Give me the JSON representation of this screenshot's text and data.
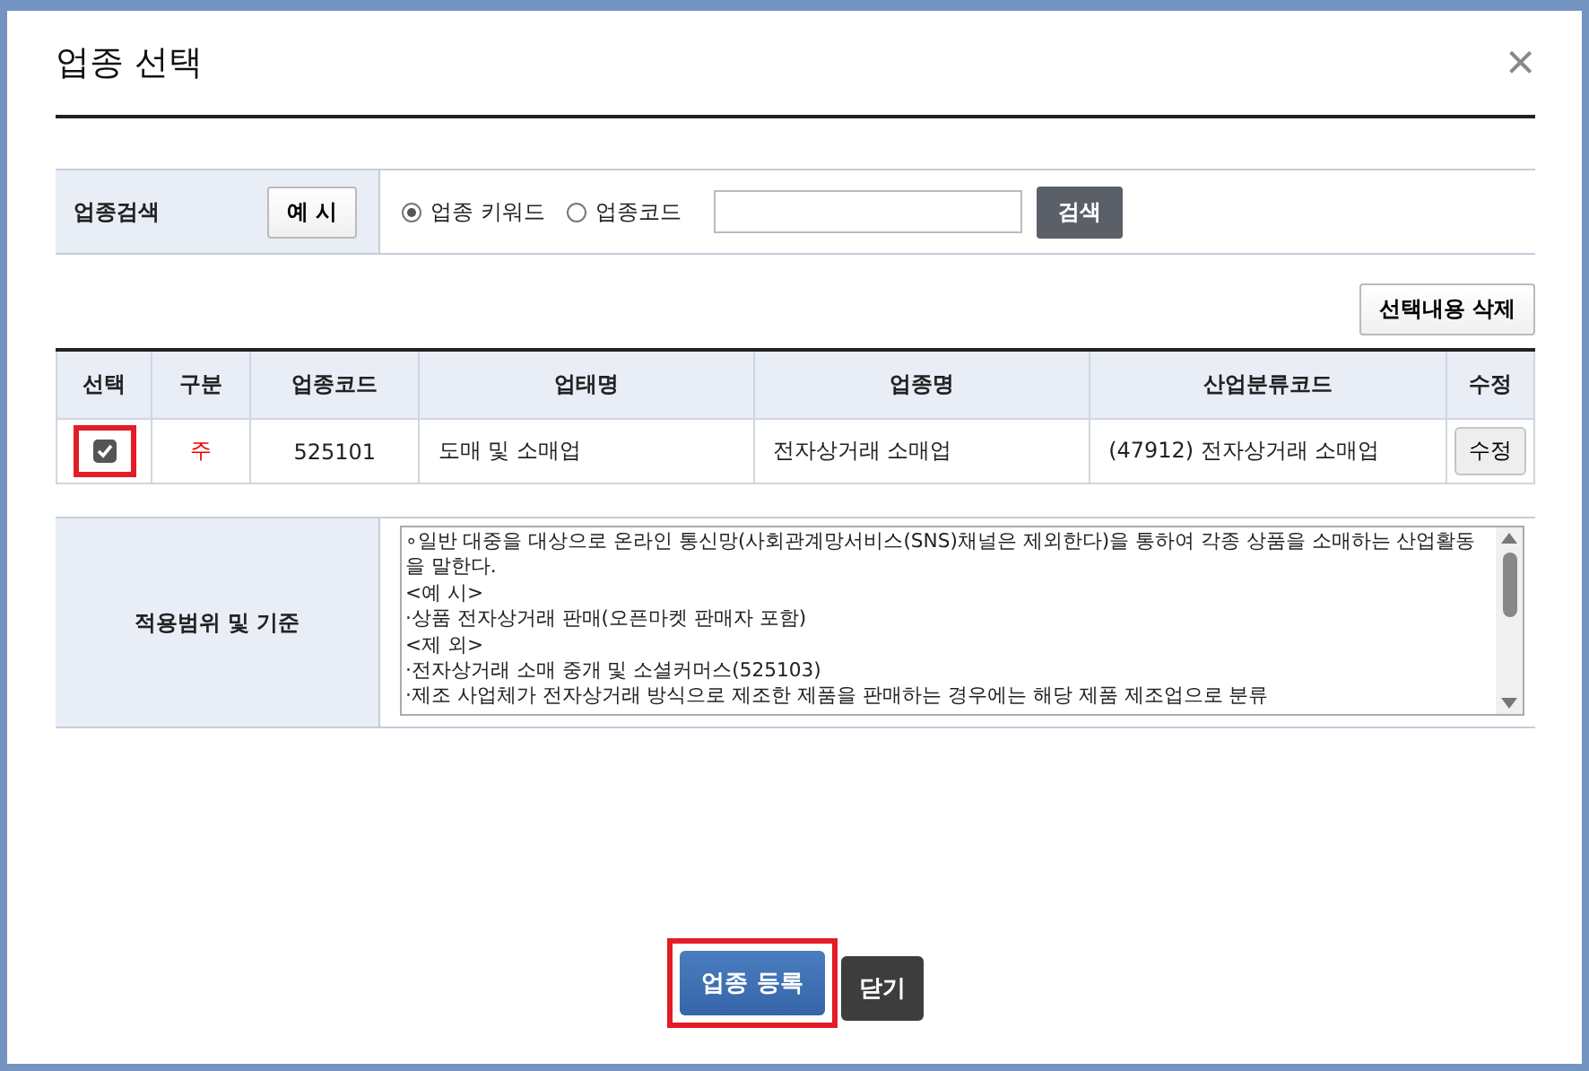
{
  "dialog": {
    "title": "업종 선택",
    "close": "×"
  },
  "search": {
    "label": "업종검색",
    "example_button": "예 시",
    "options": [
      {
        "label": "업종 키워드",
        "selected": true
      },
      {
        "label": "업종코드",
        "selected": false
      }
    ],
    "button": "검색"
  },
  "delete_button": "선택내용 삭제",
  "table": {
    "columns": [
      "선택",
      "구분",
      "업종코드",
      "업태명",
      "업종명",
      "산업분류코드",
      "수정"
    ],
    "rows": [
      {
        "checked": true,
        "highlighted": true,
        "type": "주",
        "code": "525101",
        "business_type": "도매 및 소매업",
        "industry": "전자상거래 소매업",
        "classification": "(47912) 전자상거래 소매업",
        "edit": "수정"
      }
    ]
  },
  "scope": {
    "label": "적용범위 및 기준",
    "lines": [
      "∘일반 대중을 대상으로 온라인 통신망(사회관계망서비스(SNS)채널은 제외한다)을 통하여 각종 상품을 소매하는 산업활동을 말한다.",
      "<예 시>",
      "·상품 전자상거래 판매(오픈마켓 판매자 포함)",
      "<제 외>",
      "·전자상거래 소매 중개 및 소셜커머스(525103)",
      "·제조 사업체가 전자상거래 방식으로 제조한 제품을 판매하는 경우에는 해당 제품 제조업으로 분류"
    ]
  },
  "footer": {
    "register": {
      "label": "업종 등록",
      "highlighted": true
    },
    "close": "닫기"
  }
}
